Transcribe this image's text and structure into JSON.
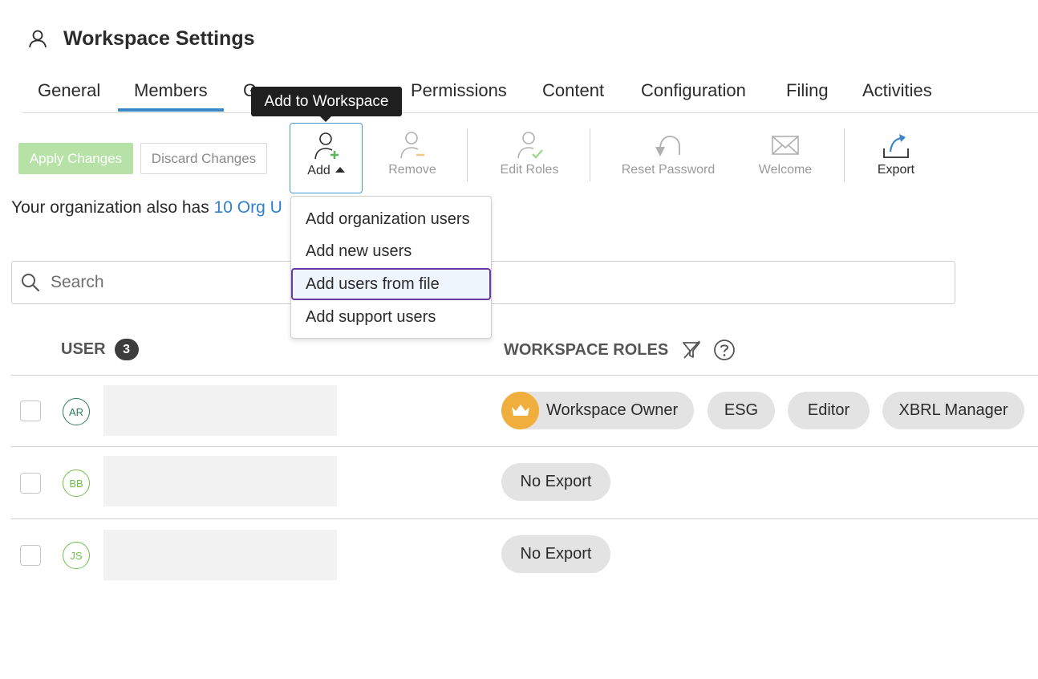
{
  "header": {
    "icon": "user-icon",
    "title": "Workspace Settings"
  },
  "tabs": [
    {
      "label": "General",
      "active": false
    },
    {
      "label": "Members",
      "active": true
    },
    {
      "label": "G",
      "active": false
    },
    {
      "label": "Permissions",
      "active": false
    },
    {
      "label": "Content",
      "active": false
    },
    {
      "label": "Configuration",
      "active": false
    },
    {
      "label": "Filing",
      "active": false
    },
    {
      "label": "Activities",
      "active": false
    }
  ],
  "tooltip": "Add to Workspace",
  "actions": {
    "apply": "Apply Changes",
    "discard": "Discard Changes"
  },
  "toolbar": {
    "add": "Add",
    "remove": "Remove",
    "edit_roles": "Edit Roles",
    "reset_password": "Reset Password",
    "welcome": "Welcome",
    "export": "Export"
  },
  "info": {
    "prefix": "Your organization also has ",
    "link": "10 Org U"
  },
  "search": {
    "placeholder": "Search"
  },
  "add_menu": {
    "items": [
      "Add organization users",
      "Add new users",
      "Add users from file",
      "Add support users"
    ],
    "highlighted": "Add users from file"
  },
  "table": {
    "user_header": "USER",
    "user_count": "3",
    "roles_header": "WORKSPACE ROLES",
    "rows": [
      {
        "initials": "AR",
        "roles": [
          "Workspace Owner",
          "ESG",
          "Editor",
          "XBRL Manager"
        ]
      },
      {
        "initials": "BB",
        "roles": [
          "No Export"
        ]
      },
      {
        "initials": "JS",
        "roles": [
          "No Export"
        ]
      }
    ]
  },
  "colors": {
    "accent": "#3b86c7",
    "apply_disabled": "#b6e2a8",
    "owner_badge": "#f0ae3c",
    "menu_highlight_border": "#6b3aa0",
    "avatar_ar": "#2e7d5b",
    "avatar_green": "#6fbf4a"
  }
}
